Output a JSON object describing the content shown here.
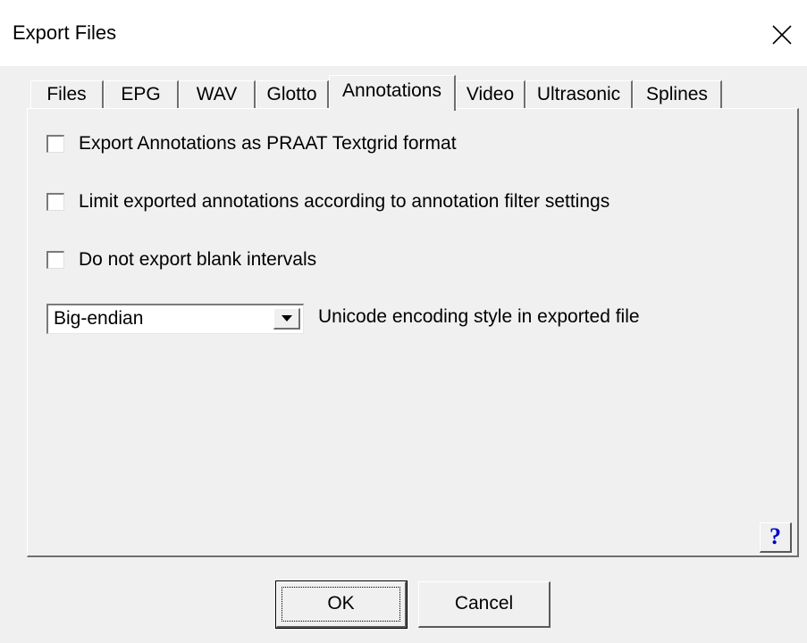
{
  "window": {
    "title": "Export Files"
  },
  "tabs": [
    {
      "label": "Files",
      "active": false
    },
    {
      "label": "EPG",
      "active": false
    },
    {
      "label": "WAV",
      "active": false
    },
    {
      "label": "Glotto",
      "active": false
    },
    {
      "label": "Annotations",
      "active": true
    },
    {
      "label": "Video",
      "active": false
    },
    {
      "label": "Ultrasonic",
      "active": false
    },
    {
      "label": "Splines",
      "active": false
    }
  ],
  "options": {
    "praat_label": "Export Annotations as PRAAT Textgrid format",
    "praat_checked": false,
    "limit_label": "Limit exported annotations according to annotation filter settings",
    "limit_checked": false,
    "blank_label": "Do not export blank intervals",
    "blank_checked": false
  },
  "encoding": {
    "value": "Big-endian",
    "label": "Unicode encoding style in exported file"
  },
  "buttons": {
    "help": "?",
    "ok": "OK",
    "cancel": "Cancel"
  },
  "icons": {
    "close": "close-icon",
    "dropdown": "chevron-down-icon"
  }
}
